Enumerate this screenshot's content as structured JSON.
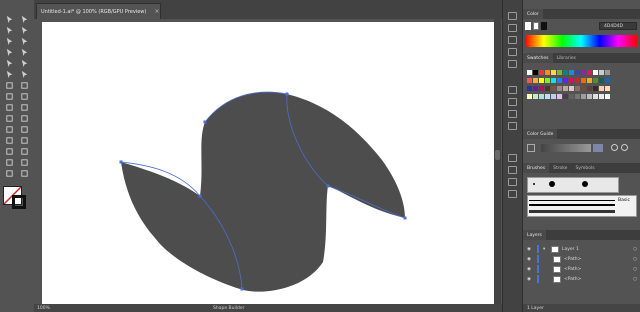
{
  "document": {
    "tab_title": "Untitled-1.ai* @ 100% (RGB/GPU Preview)",
    "close_glyph": "×"
  },
  "status": {
    "zoom": "100%",
    "tool_name": "Shape Builder"
  },
  "colors": {
    "shape_fill": "#4D4D4D",
    "path_stroke": "#4a6fd0",
    "artboard": "#ffffff",
    "ui_bg": "#535353"
  },
  "color_panel": {
    "tab": "Color",
    "hex_value": "4D4D4D"
  },
  "swatches_panel": {
    "tabs": [
      "Swatches",
      "Libraries"
    ]
  },
  "color_guide_panel": {
    "tab": "Color Guide"
  },
  "brushes_panel": {
    "tabs": [
      "Brushes",
      "Stroke",
      "Symbols"
    ],
    "basic_label": "Basic"
  },
  "layers_panel": {
    "tab": "Layers",
    "layer_name": "Layer 1",
    "paths": [
      "<Path>",
      "<Path>",
      "<Path>"
    ],
    "count_label": "1 Layer"
  },
  "toolbar": {
    "icons": [
      "selection-tool-icon",
      "direct-selection-tool-icon",
      "magic-wand-tool-icon",
      "lasso-tool-icon",
      "pen-tool-icon",
      "curvature-tool-icon",
      "type-tool-icon",
      "line-segment-tool-icon",
      "rectangle-tool-icon",
      "paintbrush-tool-icon",
      "shaper-tool-icon",
      "pencil-tool-icon",
      "eraser-tool-icon",
      "scissors-tool-icon",
      "rotate-tool-icon",
      "scale-tool-icon",
      "width-tool-icon",
      "free-transform-tool-icon",
      "shape-builder-tool-icon",
      "perspective-grid-tool-icon",
      "mesh-tool-icon",
      "gradient-tool-icon",
      "eyedropper-tool-icon",
      "blend-tool-icon",
      "symbol-sprayer-tool-icon",
      "column-graph-tool-icon",
      "artboard-tool-icon",
      "slice-tool-icon",
      "hand-tool-icon",
      "zoom-tool-icon"
    ]
  }
}
